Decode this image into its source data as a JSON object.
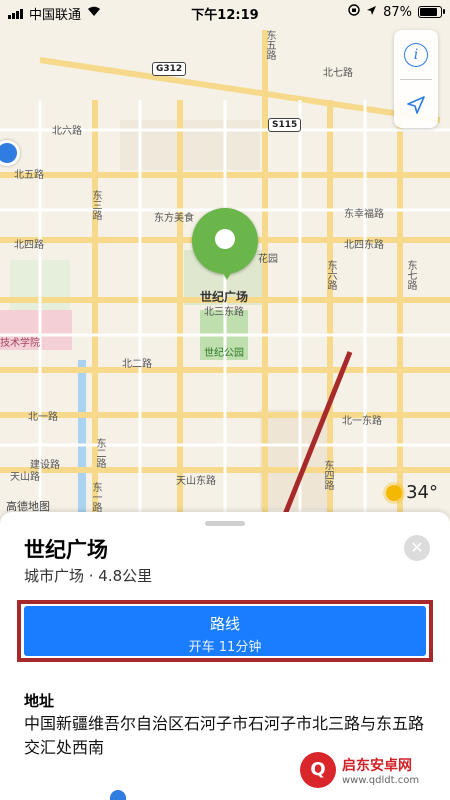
{
  "status_bar": {
    "carrier": "中国联通",
    "time": "下午12:19",
    "battery": "87%"
  },
  "map": {
    "road_labels": [
      {
        "id": "north-seven",
        "text": "北七路"
      },
      {
        "id": "north-six",
        "text": "北六路"
      },
      {
        "id": "north-five",
        "text": "北五路"
      },
      {
        "id": "north-four",
        "text": "北四路"
      },
      {
        "id": "north-four-east",
        "text": "北四东路"
      },
      {
        "id": "dongfeng",
        "text": "东幸福路"
      },
      {
        "id": "north-three",
        "text": "北三东路"
      },
      {
        "id": "north-two",
        "text": "北二路"
      },
      {
        "id": "north-one",
        "text": "北一路"
      },
      {
        "id": "north-one-east",
        "text": "北一东路"
      },
      {
        "id": "tianshan",
        "text": "天山路"
      },
      {
        "id": "tianshan-east",
        "text": "天山东路"
      },
      {
        "id": "jianshe",
        "text": "建设路"
      },
      {
        "id": "east-three",
        "text": "东三路"
      },
      {
        "id": "east-five",
        "text": "东五路"
      },
      {
        "id": "east-six",
        "text": "东六路"
      },
      {
        "id": "east-seven",
        "text": "东七路"
      },
      {
        "id": "east-one",
        "text": "东一路"
      },
      {
        "id": "east-two",
        "text": "东二路"
      },
      {
        "id": "east-four",
        "text": "东四路"
      }
    ],
    "poi_labels": [
      {
        "id": "dongfang",
        "text": "东方美食"
      },
      {
        "id": "garden",
        "text": "花园"
      },
      {
        "id": "plaza",
        "text": "世纪广场"
      },
      {
        "id": "park",
        "text": "世纪公园"
      },
      {
        "id": "college",
        "text": "技术学院"
      }
    ],
    "shields": [
      "G312",
      "S115"
    ],
    "attribution": "高德地图",
    "weather": {
      "temp": "34°"
    }
  },
  "controls": {
    "info_icon": "info-icon",
    "location_icon": "location-arrow-icon"
  },
  "place": {
    "name": "世纪广场",
    "subtitle": "城市广场 · 4.8公里",
    "route_label": "路线",
    "route_detail": "开车 11分钟",
    "address_label": "地址",
    "address": "中国新疆维吾尔自治区石河子市石河子市北三路与东五路交汇处西南"
  },
  "watermark": {
    "name": "启东安卓网",
    "url": "www.qdldt.com"
  }
}
